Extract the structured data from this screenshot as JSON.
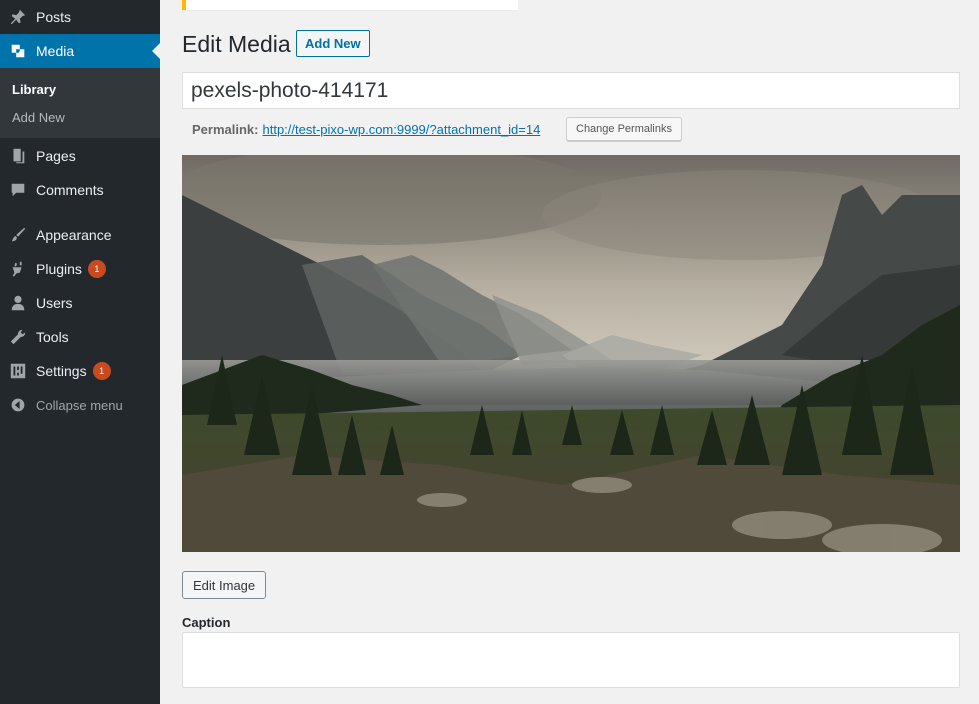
{
  "sidebar": {
    "items": [
      {
        "label": "Posts",
        "icon": "pin-icon"
      },
      {
        "label": "Media",
        "icon": "media-icon"
      },
      {
        "label": "Pages",
        "icon": "pages-icon"
      },
      {
        "label": "Comments",
        "icon": "comments-icon"
      },
      {
        "label": "Appearance",
        "icon": "brush-icon"
      },
      {
        "label": "Plugins",
        "icon": "plugin-icon",
        "badge": "1"
      },
      {
        "label": "Users",
        "icon": "users-icon"
      },
      {
        "label": "Tools",
        "icon": "wrench-icon"
      },
      {
        "label": "Settings",
        "icon": "settings-icon",
        "badge": "1"
      }
    ],
    "submenu": [
      "Library",
      "Add New"
    ],
    "collapse_label": "Collapse menu",
    "active_color": "#0073aa",
    "background": "#23282d"
  },
  "main": {
    "title": "Edit Media",
    "add_new_label": "Add New",
    "title_value": "pexels-photo-414171",
    "permalink_label": "Permalink:",
    "permalink_url": "http://test-pixo-wp.com:9999/?attachment_id=14",
    "change_permalinks_label": "Change Permalinks",
    "edit_image_label": "Edit Image",
    "caption_label": "Caption",
    "caption_value": ""
  },
  "colors": {
    "notice_border": "#ffb900",
    "badge": "#ca4a1f",
    "link": "#0073aa"
  }
}
